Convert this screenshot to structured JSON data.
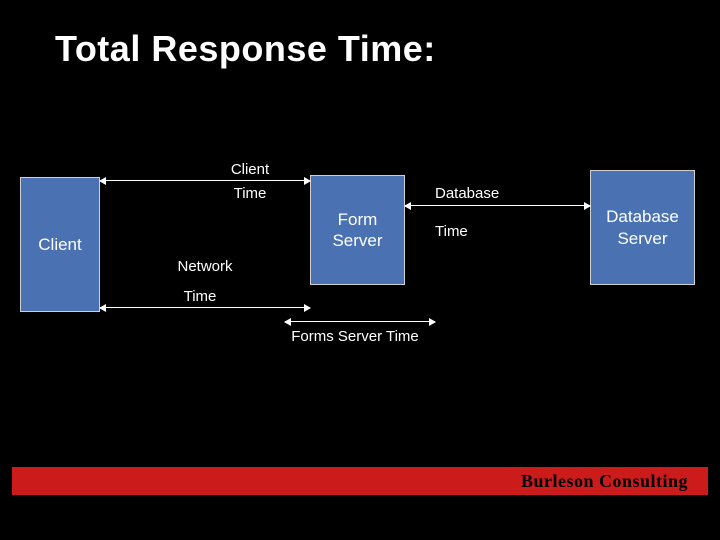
{
  "title": "Total Response Time:",
  "boxes": {
    "client": "Client",
    "form": "Form\nServer",
    "database": "Database\nServer"
  },
  "labels": {
    "client_word": "Client",
    "client_time": "Time",
    "database_word": "Database",
    "database_time": "Time",
    "network_word": "Network",
    "network_time": "Time",
    "forms_time": "Forms Server Time"
  },
  "footer": {
    "company": "Burleson Consulting"
  },
  "chart_data": {
    "type": "diagram",
    "title": "Total Response Time",
    "nodes": [
      {
        "id": "client",
        "label": "Client"
      },
      {
        "id": "form_server",
        "label": "Form Server"
      },
      {
        "id": "database_server",
        "label": "Database Server"
      }
    ],
    "edges": [
      {
        "from": "client",
        "to": "form_server",
        "label": "Client Time",
        "bidirectional": true
      },
      {
        "from": "form_server",
        "to": "database_server",
        "label": "Database Time",
        "bidirectional": true
      },
      {
        "from": "client",
        "to": "form_server",
        "label": "Network Time",
        "bidirectional": true
      },
      {
        "from": "form_server",
        "to": "form_server",
        "label": "Forms Server Time",
        "bidirectional": true
      }
    ]
  }
}
